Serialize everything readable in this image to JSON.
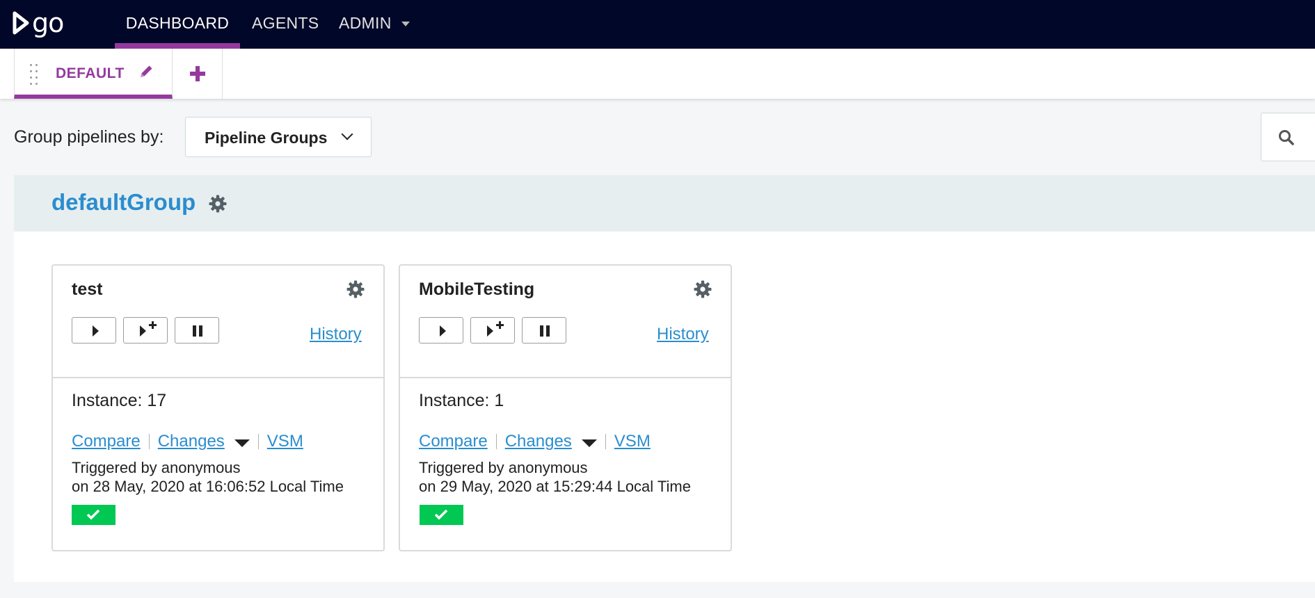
{
  "brand": {
    "logo_text": "go"
  },
  "nav": {
    "items": [
      {
        "label": "DASHBOARD",
        "active": true
      },
      {
        "label": "AGENTS",
        "active": false
      },
      {
        "label": "ADMIN",
        "active": false,
        "has_dropdown": true
      }
    ]
  },
  "tabs": {
    "items": [
      {
        "label": "DEFAULT",
        "active": true
      }
    ],
    "add_icon": "plus-icon",
    "edit_icon": "pencil-icon"
  },
  "toolbar": {
    "group_by_label": "Group pipelines by:",
    "group_by_value": "Pipeline Groups",
    "search_icon": "search-icon"
  },
  "group": {
    "name": "defaultGroup",
    "settings_icon": "gear-icon"
  },
  "pipelines": [
    {
      "name": "test",
      "history_label": "History",
      "instance_label": "Instance: 17",
      "links": {
        "compare": "Compare",
        "changes": "Changes",
        "vsm": "VSM"
      },
      "triggered_by": "Triggered by anonymous",
      "triggered_on": "on 28 May, 2020 at 16:06:52 Local Time",
      "stage_status": "passed"
    },
    {
      "name": "MobileTesting",
      "history_label": "History",
      "instance_label": "Instance: 1",
      "links": {
        "compare": "Compare",
        "changes": "Changes",
        "vsm": "VSM"
      },
      "triggered_by": "Triggered by anonymous",
      "triggered_on": "on 29 May, 2020 at 15:29:44 Local Time",
      "stage_status": "passed"
    }
  ],
  "colors": {
    "nav_bg": "#000728",
    "accent": "#943a9e",
    "link": "#2a8dce",
    "passed": "#00c853"
  }
}
